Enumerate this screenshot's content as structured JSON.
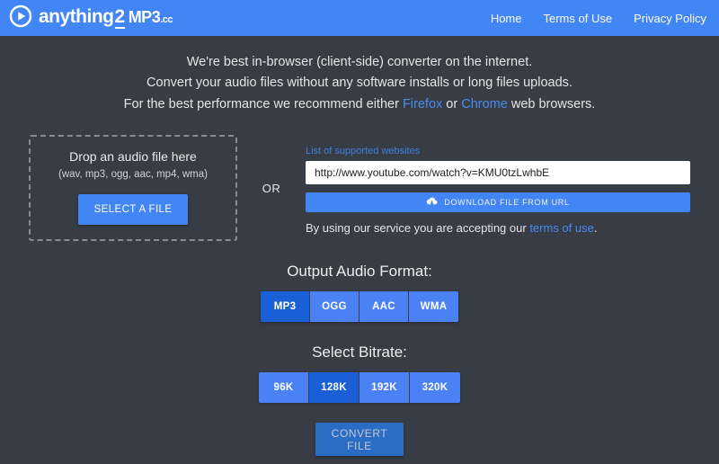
{
  "header": {
    "brand": {
      "icon": "play-circle-icon",
      "word": "anything",
      "two": "2",
      "mp3": "MP3",
      "cc": ".cc"
    },
    "nav": [
      {
        "label": "Home"
      },
      {
        "label": "Terms of Use"
      },
      {
        "label": "Privacy Policy"
      }
    ]
  },
  "intro": {
    "line1": "We're best in-browser (client-side) converter on the internet.",
    "line2": "Convert your audio files without any software installs or long files uploads.",
    "line3_pre": "For the best performance we recommend either ",
    "line3_link1": "Firefox",
    "line3_mid": " or ",
    "line3_link2": "Chrome",
    "line3_post": " web browsers."
  },
  "upload": {
    "dropzone": {
      "title": "Drop an audio file here",
      "formats": "(wav, mp3, ogg, aac, mp4, wma)",
      "select_button": "SELECT A FILE"
    },
    "or": "OR",
    "url": {
      "supported_link": "List of supported websites",
      "value": "http://www.youtube.com/watch?v=KMU0tzLwhbE",
      "placeholder": "http://www.youtube.com/watch?v=KMU0tzLwhbE",
      "download_button": "DOWNLOAD FILE FROM URL",
      "download_icon": "cloud-download-icon",
      "terms_pre": "By using our service you are accepting our ",
      "terms_link": "terms of use",
      "terms_post": "."
    }
  },
  "format": {
    "title": "Output Audio Format:",
    "options": [
      {
        "label": "MP3",
        "selected": true
      },
      {
        "label": "OGG",
        "selected": false
      },
      {
        "label": "AAC",
        "selected": false
      },
      {
        "label": "WMA",
        "selected": false
      }
    ],
    "selected": "MP3"
  },
  "bitrate": {
    "title": "Select Bitrate:",
    "options": [
      {
        "label": "96K",
        "selected": false
      },
      {
        "label": "128K",
        "selected": true
      },
      {
        "label": "192K",
        "selected": false
      },
      {
        "label": "320K",
        "selected": false
      }
    ],
    "selected": "128K"
  },
  "convert": {
    "label": "CONVERT FILE"
  },
  "colors": {
    "header_blue": "#4285f4",
    "background": "#383c44",
    "accent_blue": "#4a82f5",
    "active_blue": "#1a5fd6",
    "convert_blue": "#2b6cc4",
    "link_blue": "#4a8bf0"
  }
}
